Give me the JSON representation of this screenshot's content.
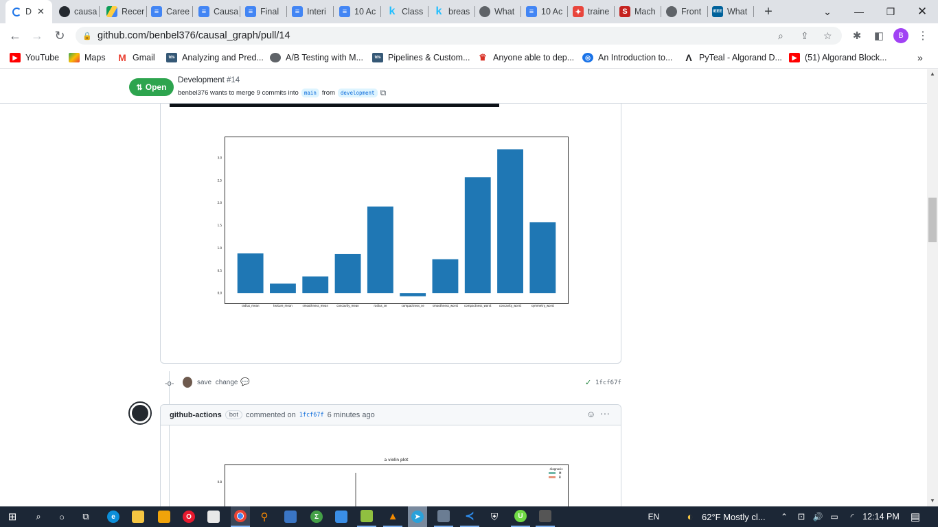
{
  "browser": {
    "tabs": [
      {
        "label": "D",
        "icon": "loading-icon",
        "active": true
      },
      {
        "label": "causa",
        "icon": "github-icon"
      },
      {
        "label": "Recer",
        "icon": "google-drive-icon"
      },
      {
        "label": "Caree",
        "icon": "google-docs-icon"
      },
      {
        "label": "Causa",
        "icon": "google-docs-icon"
      },
      {
        "label": "Final",
        "icon": "google-docs-icon"
      },
      {
        "label": "Interi",
        "icon": "google-docs-icon"
      },
      {
        "label": "10 Ac",
        "icon": "google-docs-icon"
      },
      {
        "label": "Class",
        "icon": "kaggle-icon"
      },
      {
        "label": "breas",
        "icon": "kaggle-icon"
      },
      {
        "label": "What",
        "icon": "globe-icon"
      },
      {
        "label": "10 Ac",
        "icon": "google-docs-icon"
      },
      {
        "label": "traine",
        "icon": "app-icon"
      },
      {
        "label": "Mach",
        "icon": "s-icon"
      },
      {
        "label": "Front",
        "icon": "globe-icon"
      },
      {
        "label": "What",
        "icon": "ieee-icon"
      }
    ],
    "new_tab": "+",
    "url": "github.com/benbel376/causal_graph/pull/14",
    "profile_initial": "B",
    "bookmarks": [
      {
        "label": "YouTube",
        "icon": "youtube-icon"
      },
      {
        "label": "Maps",
        "icon": "maps-icon"
      },
      {
        "label": "Gmail",
        "icon": "gmail-icon"
      },
      {
        "label": "Analyzing and Pred...",
        "icon": "tds-icon"
      },
      {
        "label": "A/B Testing with M...",
        "icon": "analytics-icon"
      },
      {
        "label": "Pipelines & Custom...",
        "icon": "tds-icon"
      },
      {
        "label": "Anyone able to dep...",
        "icon": "crown-icon"
      },
      {
        "label": "An Introduction to...",
        "icon": "algorand-icon"
      },
      {
        "label": "PyTeal - Algorand D...",
        "icon": "pyteal-icon"
      },
      {
        "label": "(51) Algorand Block...",
        "icon": "youtube-icon"
      }
    ],
    "bookmarks_more": "»"
  },
  "pr": {
    "status": "Open",
    "title": "Development",
    "number": "#14",
    "subtitle_prefix": "benbel376 wants to merge 9 commits into",
    "base_branch": "main",
    "from_word": "from",
    "head_branch": "development"
  },
  "chart_data": {
    "type": "bar",
    "categories": [
      "radius_mean",
      "texture_mean",
      "smoothness_mean",
      "concavity_mean",
      "radius_se",
      "compactness_se",
      "smoothness_worst",
      "compactness_worst",
      "concavity_worst",
      "symmetry_worst"
    ],
    "values": [
      0.88,
      0.21,
      0.37,
      0.87,
      1.92,
      -0.07,
      0.75,
      2.57,
      3.19,
      1.57
    ],
    "yticks": [
      "0.0",
      "0.5",
      "1.0",
      "1.5",
      "2.0",
      "2.5",
      "3.0"
    ],
    "ylim": [
      -0.15,
      3.35
    ],
    "color": "#1f77b4"
  },
  "commit": {
    "message_1": "save",
    "message_2": "change",
    "sha": "1fcf67f"
  },
  "comment": {
    "author": "github-actions",
    "badge": "bot",
    "action": "commented on",
    "sha": "1fcf67f",
    "time": "6 minutes ago"
  },
  "violin": {
    "title": "a violin plot",
    "legend_title": "diagnosis",
    "legend_items": [
      {
        "label": "M",
        "color": "#6fb7a7"
      },
      {
        "label": "B",
        "color": "#e8947a"
      }
    ],
    "ytick": "0.8"
  },
  "taskbar": {
    "language": "EN",
    "weather": "62°F  Mostly cl...",
    "time": "12:14 PM"
  }
}
